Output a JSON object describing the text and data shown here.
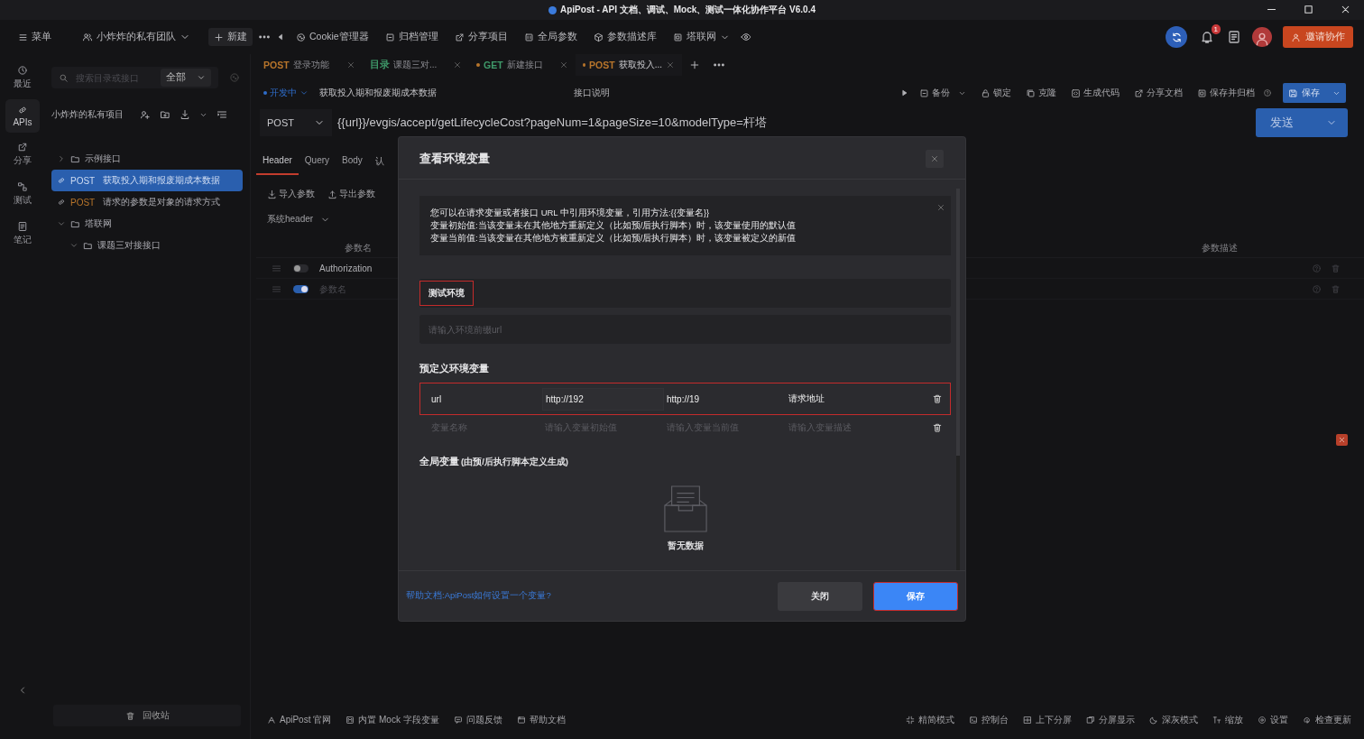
{
  "window": {
    "title": "ApiPost - API 文档、调试、Mock、测试一体化协作平台 V6.0.4"
  },
  "toolbar": {
    "menu": "菜单",
    "team": "小炸炸的私有团队",
    "new": "新建",
    "items": [
      {
        "label": "Cookie管理器"
      },
      {
        "label": "归档管理"
      },
      {
        "label": "分享项目"
      },
      {
        "label": "全局参数"
      },
      {
        "label": "参数描述库"
      }
    ],
    "project": "塔联网",
    "notification_count": "1",
    "invite": "邀请协作"
  },
  "rail": [
    {
      "label": "最近",
      "selected": false
    },
    {
      "label": "APIs",
      "selected": true
    },
    {
      "label": "分享",
      "selected": false
    },
    {
      "label": "测试",
      "selected": false
    },
    {
      "label": "笔记",
      "selected": false
    }
  ],
  "tree_panel": {
    "search": {
      "placeholder": "搜索目录或接口"
    },
    "filter": "全部",
    "project_title": "小炸炸的私有项目",
    "items": [
      {
        "kind": "folder",
        "label": "示例接口",
        "expanded": false,
        "selected": false
      },
      {
        "kind": "api",
        "method": "POST",
        "label": "获取投入期和报废期成本数据",
        "selected": true
      },
      {
        "kind": "api",
        "method": "POST",
        "label": "请求的参数是对象的请求方式",
        "selected": false
      },
      {
        "kind": "folder",
        "label": "塔联网",
        "expanded": true,
        "selected": false,
        "children": [
          {
            "kind": "folder",
            "label": "课题三对接接口",
            "expanded": true,
            "selected": false
          }
        ]
      }
    ],
    "recycle_bin": "回收站"
  },
  "open_tabs": [
    {
      "method": "POST",
      "color": "#b8752b",
      "label": "登录功能",
      "unsaved": false,
      "selected": false
    },
    {
      "method": "目录",
      "color": "#3f9a6a",
      "label": "课题三对...",
      "unsaved": false,
      "selected": false
    },
    {
      "method": "GET",
      "color": "#3f9a6a",
      "label": "新建接口",
      "unsaved": true,
      "selected": false
    },
    {
      "method": "POST",
      "color": "#b8752b",
      "label": "获取投入...",
      "unsaved": true,
      "selected": true
    }
  ],
  "api_header": {
    "status": "开发中",
    "name": "获取投入期和报废期成本数据",
    "description_tab": "接口说明",
    "actions": [
      {
        "label": "备份",
        "dropdown": true
      },
      {
        "label": "锁定",
        "dropdown": false
      },
      {
        "label": "克隆",
        "dropdown": false
      },
      {
        "label": "生成代码",
        "dropdown": false
      },
      {
        "label": "分享文档",
        "dropdown": false
      },
      {
        "label": "保存并归档",
        "dropdown": false
      }
    ],
    "save": "保存"
  },
  "url_bar": {
    "method": "POST",
    "url": "{{url}}/evgis/accept/getLifecycleCost?pageNum=1&pageSize=10&modelType=杆塔",
    "send": "发送"
  },
  "param_tabs": [
    {
      "label": "Header",
      "selected": true
    },
    {
      "label": "Query",
      "selected": false
    },
    {
      "label": "Body",
      "selected": false
    },
    {
      "label": "认",
      "selected": false
    }
  ],
  "param_tools": [
    "导入参数",
    "导出参数"
  ],
  "system_header": "系统header",
  "params_table": {
    "columns": [
      "参数名",
      "参数描述"
    ],
    "rows": [
      {
        "name": "Authorization",
        "enabled": false
      },
      {
        "placeholder": "参数名",
        "enabled": true
      }
    ]
  },
  "status_bar": {
    "left": [
      "ApiPost 官网",
      "内置 Mock 字段变量",
      "问题反馈",
      "帮助文档"
    ],
    "right": [
      "精简模式",
      "控制台",
      "上下分屏",
      "分屏显示",
      "深灰模式",
      "缩放",
      "设置",
      "检查更新"
    ]
  },
  "modal": {
    "title": "查看环境变量",
    "info": [
      "您可以在请求变量或者接口 URL 中引用环境变量，引用方法:{{变量名}}",
      "变量初始值:当该变量未在其他地方重新定义（比如预/后执行脚本）时，该变量使用的默认值",
      "变量当前值:当该变量在其他地方被重新定义（比如预/后执行脚本）时，该变量被定义的新值"
    ],
    "env_name": {
      "value": "测试环境",
      "highlighted": true
    },
    "prefix_url": {
      "placeholder": "请输入环境前缀url"
    },
    "predefined_title": "预定义环境变量",
    "variables": [
      {
        "name": "url",
        "initial": "http://192",
        "current": "http://19",
        "description": "请求地址",
        "highlighted": true
      },
      {
        "name_placeholder": "变量名称",
        "initial_placeholder": "请输入变量初始值",
        "current_placeholder": "请输入变量当前值",
        "description_placeholder": "请输入变量描述",
        "highlighted": false
      }
    ],
    "global_title": "全局变量",
    "global_note": "(由预/后执行脚本定义生成)",
    "empty_text": "暂无数据",
    "help_link": "帮助文档:ApiPost如何设置一个变量?",
    "close": "关闭",
    "save": {
      "label": "保存",
      "highlighted": true
    }
  }
}
